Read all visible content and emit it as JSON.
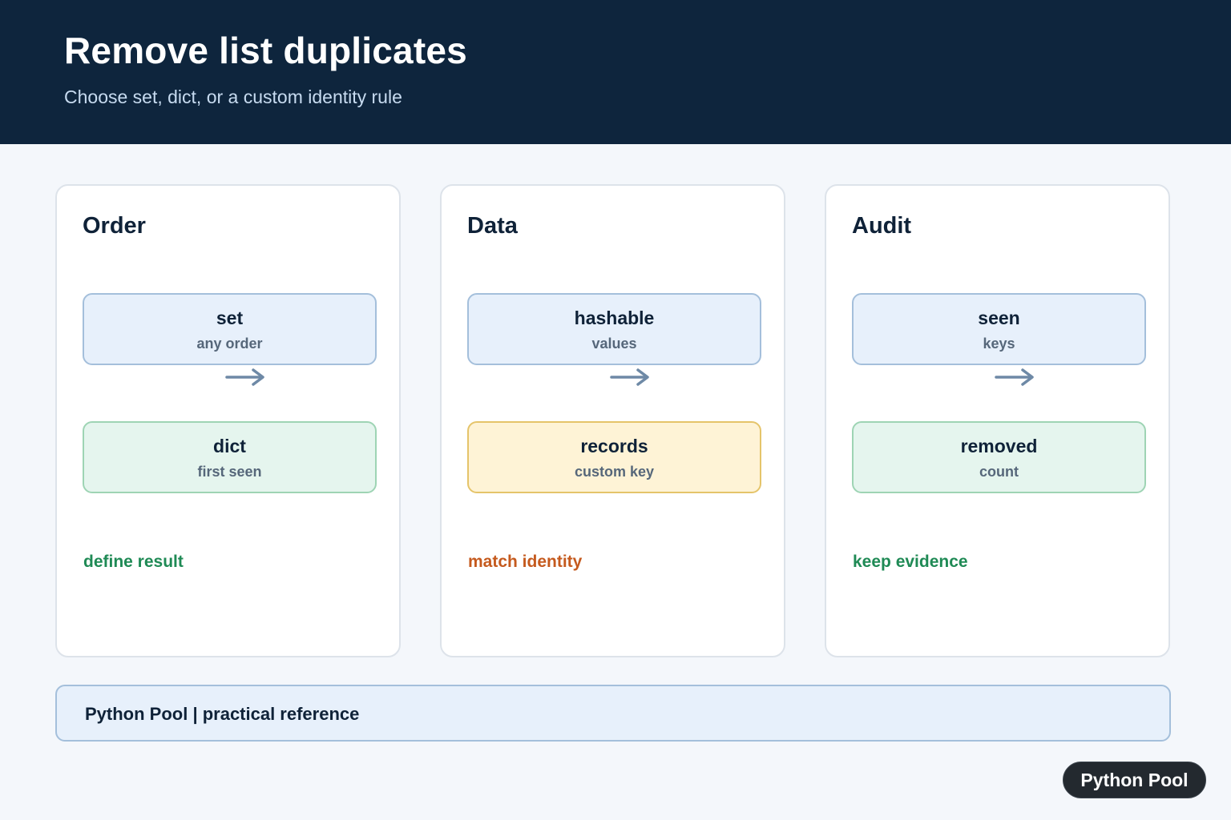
{
  "header": {
    "title": "Remove list duplicates",
    "subtitle": "Choose set, dict, or a custom identity rule"
  },
  "cards": [
    {
      "title": "Order",
      "top_node": {
        "label": "set",
        "sub": "any order"
      },
      "bottom_node": {
        "label": "dict",
        "sub": "first seen"
      },
      "footnote": "define result"
    },
    {
      "title": "Data",
      "top_node": {
        "label": "hashable",
        "sub": "values"
      },
      "bottom_node": {
        "label": "records",
        "sub": "custom key"
      },
      "footnote": "match identity"
    },
    {
      "title": "Audit",
      "top_node": {
        "label": "seen",
        "sub": "keys"
      },
      "bottom_node": {
        "label": "removed",
        "sub": "count"
      },
      "footnote": "keep evidence"
    }
  ],
  "footer": {
    "text": "Python Pool | practical reference"
  },
  "badge": {
    "label": "Python Pool"
  },
  "icons": {
    "flow_arrow": "arrow-right-icon"
  },
  "colors": {
    "header_bg": "#0e253d",
    "node_blue": "#e7f0fb",
    "node_green": "#e5f5ee",
    "node_yellow": "#fef3d6",
    "footnote_green": "#1f8a55",
    "footnote_orange": "#c55a1e",
    "arrow": "#6e89a6"
  }
}
